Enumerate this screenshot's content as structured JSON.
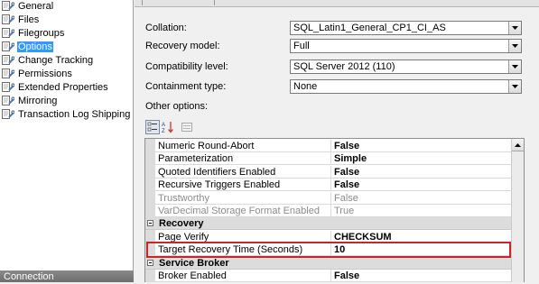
{
  "pages": [
    {
      "label": "General",
      "icon": "page-wrench-icon"
    },
    {
      "label": "Files",
      "icon": "page-wrench-icon"
    },
    {
      "label": "Filegroups",
      "icon": "page-wrench-icon"
    },
    {
      "label": "Options",
      "icon": "page-wrench-icon",
      "selected": true
    },
    {
      "label": "Change Tracking",
      "icon": "page-wrench-icon"
    },
    {
      "label": "Permissions",
      "icon": "page-wrench-icon"
    },
    {
      "label": "Extended Properties",
      "icon": "page-wrench-icon"
    },
    {
      "label": "Mirroring",
      "icon": "page-wrench-icon"
    },
    {
      "label": "Transaction Log Shipping",
      "icon": "page-wrench-icon"
    }
  ],
  "connection_header": "Connection",
  "fields": {
    "collation": {
      "label": "Collation:",
      "value": "SQL_Latin1_General_CP1_CI_AS"
    },
    "recovery_model": {
      "label": "Recovery model:",
      "value": "Full"
    },
    "compatibility_level": {
      "label": "Compatibility level:",
      "value": "SQL Server 2012 (110)"
    },
    "containment_type": {
      "label": "Containment type:",
      "value": "None"
    }
  },
  "other_options_label": "Other options:",
  "toolbar": {
    "sort_categorized_icon": "categorized-icon",
    "sort_alpha_icon": "sort-alphabetical-icon",
    "property_pages_icon": "property-pages-icon"
  },
  "grid_rows": [
    {
      "kind": "prop",
      "name": "Numeric Round-Abort",
      "value": "False",
      "bold": true
    },
    {
      "kind": "prop",
      "name": "Parameterization",
      "value": "Simple",
      "bold": true
    },
    {
      "kind": "prop",
      "name": "Quoted Identifiers Enabled",
      "value": "False",
      "bold": true
    },
    {
      "kind": "prop",
      "name": "Recursive Triggers Enabled",
      "value": "False",
      "bold": true
    },
    {
      "kind": "prop",
      "name": "Trustworthy",
      "value": "False",
      "readonly": true
    },
    {
      "kind": "prop",
      "name": "VarDecimal Storage Format Enabled",
      "value": "True",
      "readonly": true
    },
    {
      "kind": "category",
      "name": "Recovery"
    },
    {
      "kind": "prop",
      "name": "Page Verify",
      "value": "CHECKSUM",
      "bold": true
    },
    {
      "kind": "prop",
      "name": "Target Recovery Time (Seconds)",
      "value": "10",
      "bold": true,
      "highlighted": true
    },
    {
      "kind": "category",
      "name": "Service Broker"
    },
    {
      "kind": "prop",
      "name": "Broker Enabled",
      "value": "False",
      "bold": true
    }
  ],
  "colors": {
    "selection": "#3399ff",
    "highlight_box": "#c8242c"
  }
}
